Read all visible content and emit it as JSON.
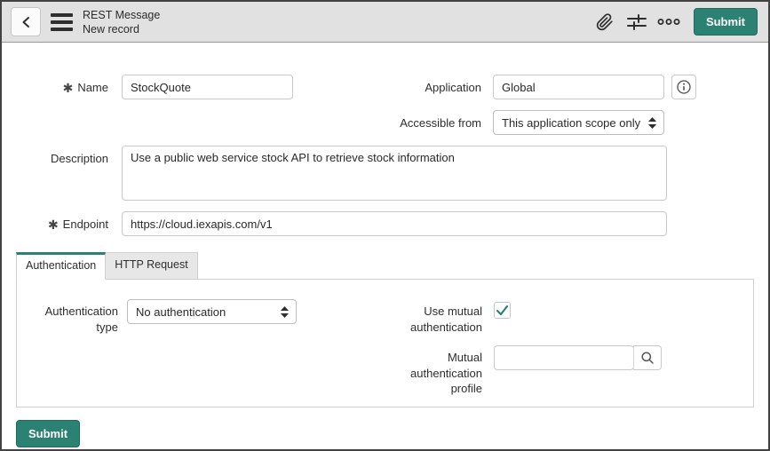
{
  "header": {
    "title": "REST Message",
    "subtitle": "New record",
    "submit_label": "Submit",
    "icons": {
      "back": "chevron-left-icon",
      "menu": "hamburger-icon",
      "attachment": "paperclip-icon",
      "personalize": "sliders-icon",
      "more": "ellipsis-icon"
    }
  },
  "form": {
    "name": {
      "label": "Name",
      "value": "StockQuote",
      "required": true
    },
    "application": {
      "label": "Application",
      "value": "Global",
      "readonly": true
    },
    "accessible_from": {
      "label": "Accessible from",
      "value": "This application scope only"
    },
    "description": {
      "label": "Description",
      "value": "Use a public web service stock API to retrieve stock information"
    },
    "endpoint": {
      "label": "Endpoint",
      "value": "https://cloud.iexapis.com/v1",
      "required": true
    }
  },
  "tabs": {
    "authentication": {
      "label": "Authentication",
      "active": true
    },
    "http_request": {
      "label": "HTTP Request",
      "active": false
    }
  },
  "auth_tab": {
    "authentication_type": {
      "label": "Authentication type",
      "value": "No authentication"
    },
    "use_mutual_authentication": {
      "label": "Use mutual authentication",
      "checked": true
    },
    "mutual_authentication_profile": {
      "label": "Mutual authentication profile",
      "value": ""
    }
  },
  "footer": {
    "submit_label": "Submit"
  },
  "colors": {
    "accent_green": "#2b8273",
    "header_bg": "#e1e1e1",
    "readonly_bg": "#e0e0e0",
    "border_gray": "#c9c9c9"
  },
  "required_marker": "✱"
}
